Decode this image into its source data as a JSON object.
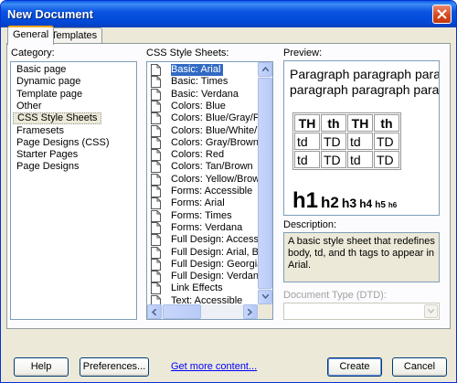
{
  "window": {
    "title": "New Document"
  },
  "tabs": [
    {
      "label": "General",
      "active": true
    },
    {
      "label": "Templates",
      "active": false
    }
  ],
  "category": {
    "label": "Category:",
    "items": [
      {
        "label": "Basic page",
        "selected": false
      },
      {
        "label": "Dynamic page",
        "selected": false
      },
      {
        "label": "Template page",
        "selected": false
      },
      {
        "label": "Other",
        "selected": false
      },
      {
        "label": "CSS Style Sheets",
        "selected": true
      },
      {
        "label": "Framesets",
        "selected": false
      },
      {
        "label": "Page Designs (CSS)",
        "selected": false
      },
      {
        "label": "Starter Pages",
        "selected": false
      },
      {
        "label": "Page Designs",
        "selected": false
      }
    ]
  },
  "css_list": {
    "label": "CSS Style Sheets:",
    "items": [
      {
        "label": "Basic: Arial",
        "selected": true
      },
      {
        "label": "Basic: Times",
        "selected": false
      },
      {
        "label": "Basic: Verdana",
        "selected": false
      },
      {
        "label": "Colors: Blue",
        "selected": false
      },
      {
        "label": "Colors: Blue/Gray/Purp",
        "selected": false
      },
      {
        "label": "Colors: Blue/White/Yell",
        "selected": false
      },
      {
        "label": "Colors: Gray/Brown",
        "selected": false
      },
      {
        "label": "Colors: Red",
        "selected": false
      },
      {
        "label": "Colors: Tan/Brown",
        "selected": false
      },
      {
        "label": "Colors: Yellow/Brown",
        "selected": false
      },
      {
        "label": "Forms: Accessible",
        "selected": false
      },
      {
        "label": "Forms: Arial",
        "selected": false
      },
      {
        "label": "Forms: Times",
        "selected": false
      },
      {
        "label": "Forms: Verdana",
        "selected": false
      },
      {
        "label": "Full Design: Accessible",
        "selected": false
      },
      {
        "label": "Full Design: Arial, Blue/",
        "selected": false
      },
      {
        "label": "Full Design: Georgia, Re",
        "selected": false
      },
      {
        "label": "Full Design: Verdana, Y",
        "selected": false
      },
      {
        "label": "Link Effects",
        "selected": false
      },
      {
        "label": "Text: Accessible",
        "selected": false
      }
    ],
    "icon": "document-icon"
  },
  "preview": {
    "label": "Preview:",
    "paragraph_lines": [
      "Paragraph paragraph parag",
      "paragraph paragraph parag"
    ],
    "table": {
      "header": [
        "TH",
        "th",
        "TH",
        "th"
      ],
      "rows": [
        [
          "td",
          "TD",
          "td",
          "TD"
        ],
        [
          "td",
          "TD",
          "td",
          "TD"
        ]
      ]
    },
    "headings": [
      "h1",
      "h2",
      "h3",
      "h4",
      "h5",
      "h6"
    ]
  },
  "description": {
    "label": "Description:",
    "text": "A basic style sheet that redefines body, td, and th tags to appear in Arial."
  },
  "doctype": {
    "label": "Document Type (DTD):",
    "value": ""
  },
  "buttons": {
    "help": "Help",
    "preferences": "Preferences...",
    "get_more": "Get more content...",
    "create": "Create",
    "cancel": "Cancel"
  },
  "colors": {
    "title_bar": "#0a54e0",
    "selection": "#316ac5",
    "dialog_bg": "#ece9d8"
  }
}
